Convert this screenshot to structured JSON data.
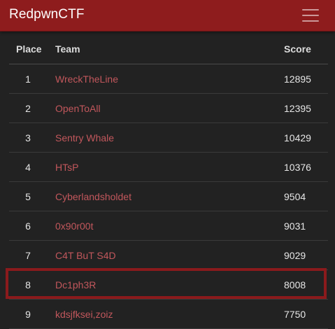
{
  "navbar": {
    "brand": "RedpwnCTF",
    "menu_icon": "hamburger-menu-icon"
  },
  "table": {
    "headers": {
      "place": "Place",
      "team": "Team",
      "score": "Score"
    },
    "rows": [
      {
        "place": "1",
        "team": "WreckTheLine",
        "score": "12895"
      },
      {
        "place": "2",
        "team": "OpenToAll",
        "score": "12395"
      },
      {
        "place": "3",
        "team": "Sentry Whale",
        "score": "10429"
      },
      {
        "place": "4",
        "team": "HTsP",
        "score": "10376"
      },
      {
        "place": "5",
        "team": "Cyberlandsholdet",
        "score": "9504"
      },
      {
        "place": "6",
        "team": "0x90r00t",
        "score": "9031"
      },
      {
        "place": "7",
        "team": "C4T BuT S4D",
        "score": "9029"
      },
      {
        "place": "8",
        "team": "Dc1ph3R",
        "score": "8008"
      },
      {
        "place": "9",
        "team": "kdsjfksei,zoiz",
        "score": "7750"
      }
    ],
    "highlighted_place": "8"
  },
  "colors": {
    "navbar_bg": "#8e1c1d",
    "page_bg": "#222222",
    "team_link": "#c2575c",
    "highlight_border": "#8b1a1c"
  }
}
